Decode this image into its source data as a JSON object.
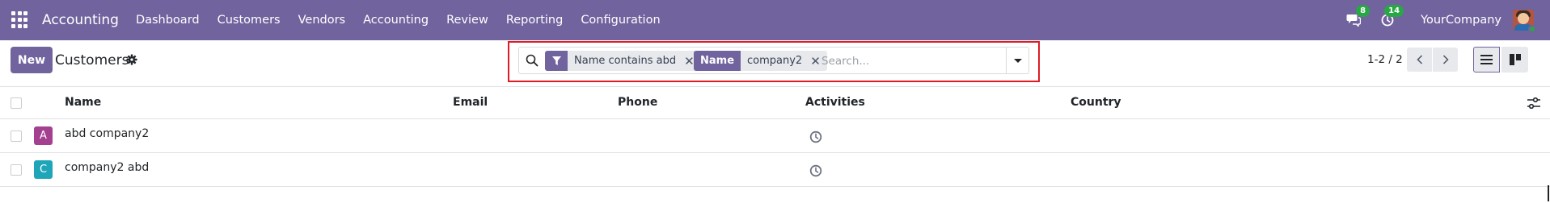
{
  "app": {
    "title": "Accounting",
    "menu": [
      "Dashboard",
      "Customers",
      "Vendors",
      "Accounting",
      "Review",
      "Reporting",
      "Configuration"
    ],
    "messages_count": "8",
    "activities_count": "14",
    "company": "YourCompany",
    "colors": {
      "navbar": "#71639e",
      "badge": "#28a745",
      "highlight_outline": "#e01b24"
    }
  },
  "control": {
    "new_label": "New",
    "title": "Customers",
    "search": {
      "facets": [
        {
          "icon": "filter-icon",
          "value": "Name contains abd"
        },
        {
          "tag": "Name",
          "value": "company2"
        }
      ],
      "placeholder": "Search..."
    },
    "pager": "1-2 / 2"
  },
  "table": {
    "columns": [
      "Name",
      "Email",
      "Phone",
      "Activities",
      "Country"
    ],
    "rows": [
      {
        "initial": "A",
        "avatar_color": "#a3408f",
        "name": "abd company2"
      },
      {
        "initial": "C",
        "avatar_color": "#1ea5b8",
        "name": "company2 abd"
      }
    ]
  }
}
